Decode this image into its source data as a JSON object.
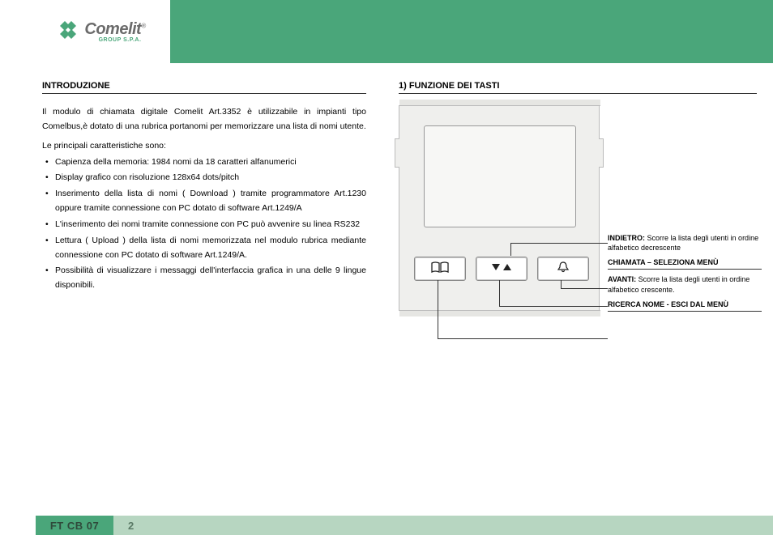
{
  "brand": {
    "name": "Comelit",
    "reg": "®",
    "sub": "GROUP S.P.A."
  },
  "left": {
    "heading": "INTRODUZIONE",
    "para": "Il modulo di chiamata digitale Comelit Art.3352 è utilizzabile in impianti tipo Comelbus,è dotato di una rubrica portanomi  per memorizzare una lista di nomi utente.",
    "sub": "Le principali caratteristiche sono:",
    "features": [
      "Capienza della memoria: 1984 nomi da 18 caratteri alfanumerici",
      "Display grafico con risoluzione 128x64 dots/pitch",
      "Inserimento della lista di nomi ( Download ) tramite programmatore Art.1230 oppure tramite connessione con PC dotato di software Art.1249/A",
      "L'inserimento dei nomi tramite connessione con PC può avvenire su linea RS232",
      "Lettura ( Upload ) della lista di nomi memorizzata nel modulo rubrica mediante connessione con PC dotato di software Art.1249/A.",
      "Possibilità di visualizzare i messaggi dell'interfaccia grafica in una delle 9 lingue disponibili."
    ]
  },
  "right": {
    "heading": "1) FUNZIONE DEI TASTI",
    "callouts": {
      "indietro_label": "INDIETRO:",
      "indietro_desc": " Scorre la lista degli utenti in ordine alfabetico decrescente",
      "chiamata": "CHIAMATA – SELEZIONA MENÙ",
      "avanti_label": "AVANTI:",
      "avanti_desc": " Scorre la lista degli utenti in ordine alfabetico crescente.",
      "ricerca": "RICERCA NOME - ESCI DAL MENÙ"
    },
    "icons": {
      "book": "book-icon",
      "arrows": "up-down-icon",
      "bell": "bell-icon"
    }
  },
  "footer": {
    "code": "FT CB 07",
    "page": "2"
  }
}
